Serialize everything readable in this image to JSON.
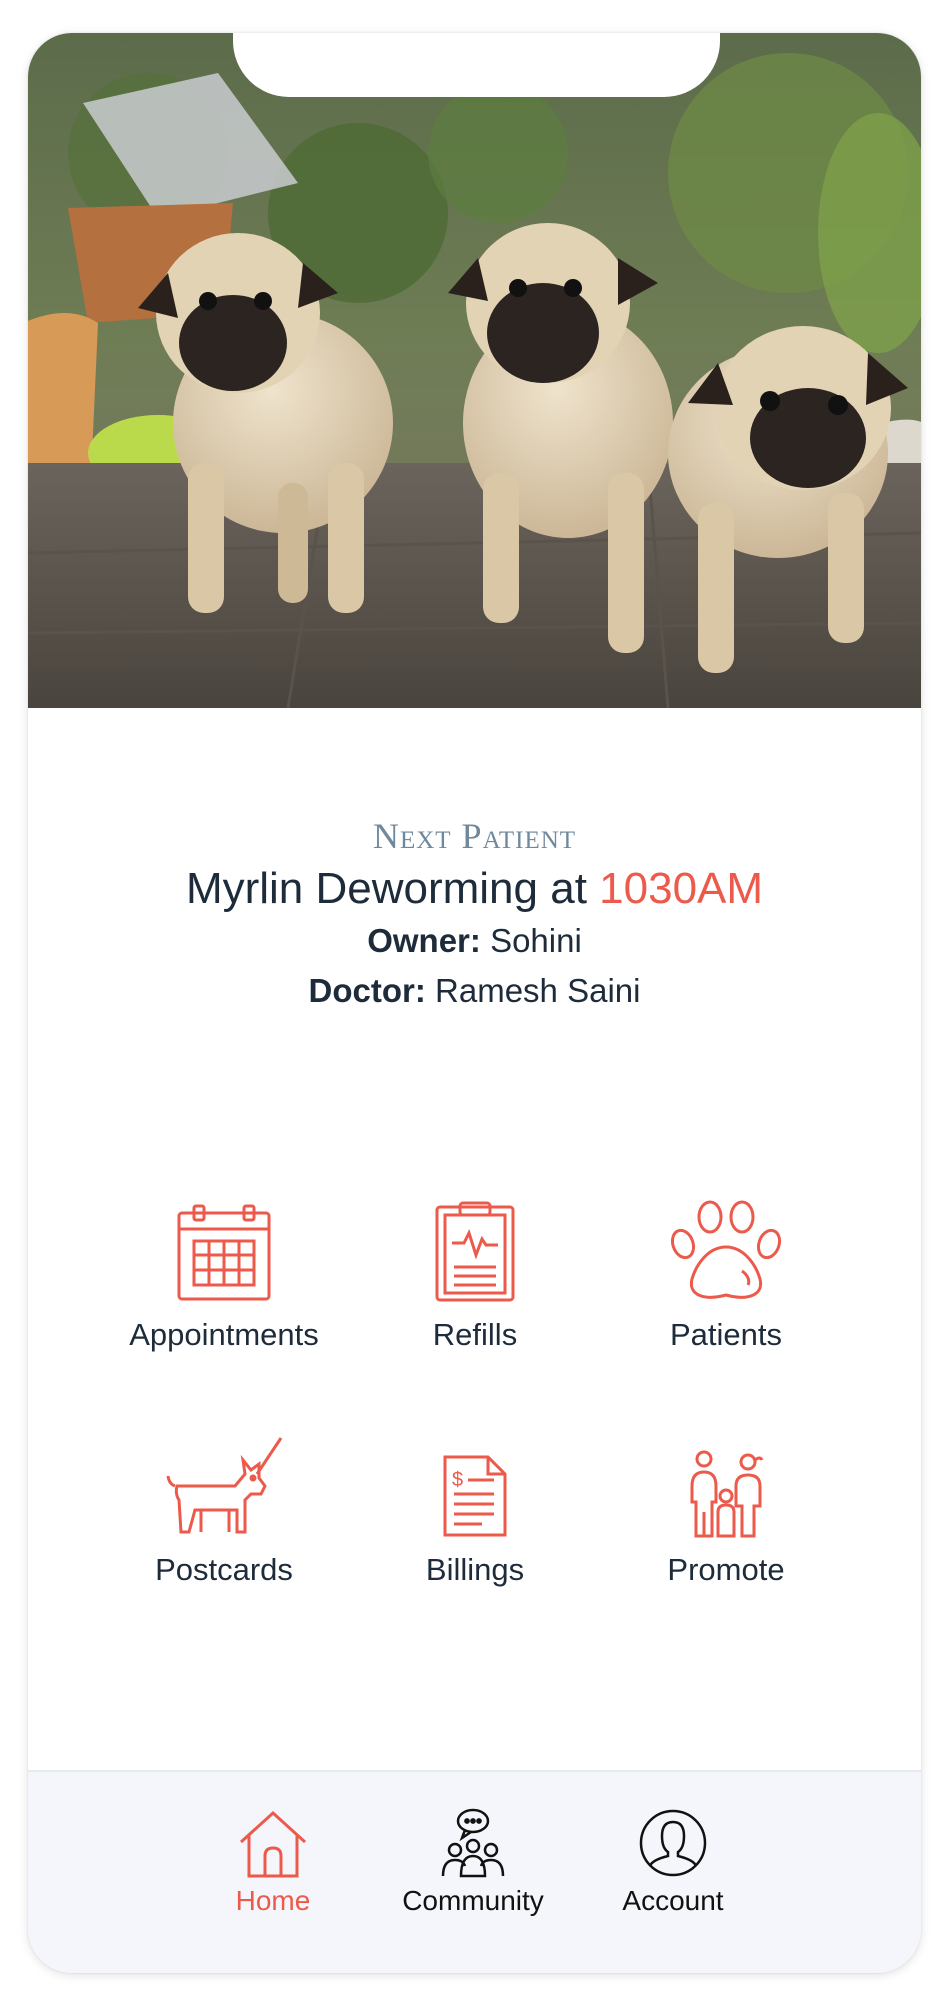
{
  "hero": {
    "icon": "pug-photo"
  },
  "next_patient": {
    "label": "Next Patient",
    "title_prefix": "Myrlin Deworming at",
    "time": "1030AM",
    "owner_label": "Owner:",
    "owner_value": "Sohini",
    "doctor_label": "Doctor:",
    "doctor_value": "Ramesh Saini"
  },
  "actions": [
    {
      "label": "Appointments",
      "icon": "calendar-icon"
    },
    {
      "label": "Refills",
      "icon": "clipboard-icon"
    },
    {
      "label": "Patients",
      "icon": "paw-icon"
    },
    {
      "label": "Postcards",
      "icon": "dog-icon"
    },
    {
      "label": "Billings",
      "icon": "invoice-icon"
    },
    {
      "label": "Promote",
      "icon": "family-icon"
    }
  ],
  "tabs": [
    {
      "label": "Home",
      "icon": "home-icon",
      "active": true
    },
    {
      "label": "Community",
      "icon": "community-icon",
      "active": false
    },
    {
      "label": "Account",
      "icon": "account-icon",
      "active": false
    }
  ],
  "colors": {
    "accent": "#ec5a4b",
    "text": "#1d2b3a",
    "muted": "#6f889c",
    "tabbar_bg": "#f4f6fb"
  }
}
